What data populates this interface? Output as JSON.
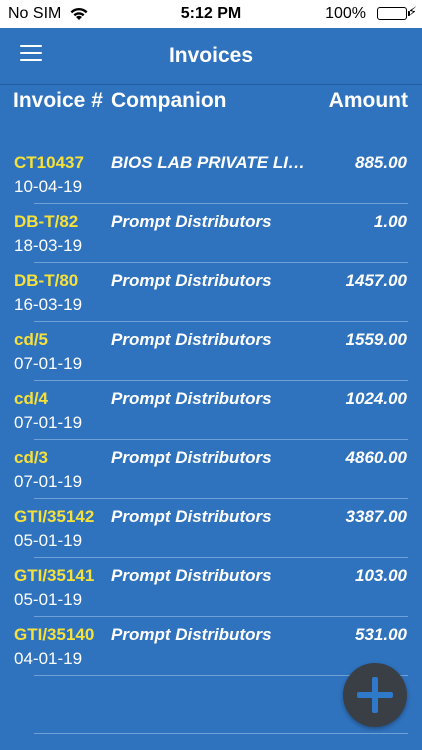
{
  "status_bar": {
    "carrier": "No SIM",
    "time": "5:12 PM",
    "battery_percent": "100%",
    "battery_level": 1.0,
    "battery_color": "#4cd964",
    "icons": [
      "wifi-icon",
      "battery-icon",
      "charging-bolt-icon"
    ]
  },
  "navbar": {
    "title": "Invoices",
    "menu_icon": "hamburger-menu-icon"
  },
  "table": {
    "headers": {
      "invoice": "Invoice #",
      "companion": "Companion",
      "amount": "Amount"
    },
    "rows": [
      {
        "invoice": "CT10437",
        "date": "10-04-19",
        "companion": "BIOS LAB PRIVATE LIMITED",
        "amount": "885.00"
      },
      {
        "invoice": "DB-T/82",
        "date": "18-03-19",
        "companion": "Prompt Distributors",
        "amount": "1.00"
      },
      {
        "invoice": "DB-T/80",
        "date": "16-03-19",
        "companion": "Prompt Distributors",
        "amount": "1457.00"
      },
      {
        "invoice": "cd/5",
        "date": "07-01-19",
        "companion": "Prompt Distributors",
        "amount": "1559.00"
      },
      {
        "invoice": "cd/4",
        "date": "07-01-19",
        "companion": "Prompt Distributors",
        "amount": "1024.00"
      },
      {
        "invoice": "cd/3",
        "date": "07-01-19",
        "companion": "Prompt Distributors",
        "amount": "4860.00"
      },
      {
        "invoice": "GTI/35142",
        "date": "05-01-19",
        "companion": "Prompt Distributors",
        "amount": "3387.00"
      },
      {
        "invoice": "GTI/35141",
        "date": "05-01-19",
        "companion": "Prompt Distributors",
        "amount": "103.00"
      },
      {
        "invoice": "GTI/35140",
        "date": "04-01-19",
        "companion": "Prompt Distributors",
        "amount": "531.00"
      }
    ]
  },
  "fab": {
    "icon": "plus-icon"
  },
  "colors": {
    "background": "#2f72be",
    "invoice_number": "#f6e13a",
    "text": "#ffffff",
    "fab_background": "#3a3f45",
    "fab_icon": "#2f79c9"
  }
}
